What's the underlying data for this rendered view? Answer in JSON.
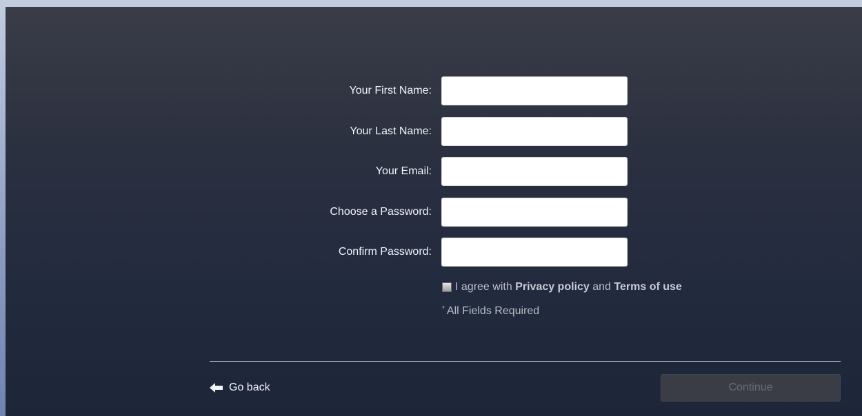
{
  "form": {
    "fields": [
      {
        "label": "Your First Name:",
        "value": "",
        "placeholder": ""
      },
      {
        "label": "Your Last Name:",
        "value": "",
        "placeholder": ""
      },
      {
        "label": "Your Email:",
        "value": "",
        "placeholder": ""
      },
      {
        "label": "Choose a Password:",
        "value": "",
        "placeholder": ""
      },
      {
        "label": "Confirm Password:",
        "value": "",
        "placeholder": ""
      }
    ],
    "agree": {
      "prefix": "I agree with",
      "privacy_link": "Privacy policy",
      "conjunction": "and",
      "terms_link": "Terms of use",
      "checked": false
    },
    "required_star": "*",
    "required_note": "All Fields Required"
  },
  "footer": {
    "go_back_label": "Go back",
    "go_back_icon": "arrow-left-icon",
    "continue_label": "Continue",
    "continue_enabled": false
  },
  "colors": {
    "panel_top": "#3a3d47",
    "panel_bottom": "#1d2538",
    "label_text": "#f2f4f8",
    "muted_text": "#b9bdc6",
    "continue_disabled_bg": "#3a3d45"
  }
}
